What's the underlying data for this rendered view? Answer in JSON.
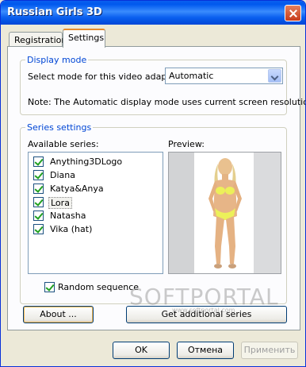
{
  "window": {
    "title": "Russian Girls 3D"
  },
  "tabs": [
    {
      "label": "Registration"
    },
    {
      "label": "Settings"
    }
  ],
  "display_mode": {
    "group_title": "Display mode",
    "select_label": "Select mode for this video adapter :",
    "select_value": "Automatic",
    "note": "Note: The Automatic display mode uses current screen resolution."
  },
  "series_settings": {
    "group_title": "Series settings",
    "available_label": "Available series:",
    "preview_label": "Preview:",
    "items": [
      {
        "label": "Anything3DLogo",
        "checked": true
      },
      {
        "label": "Diana",
        "checked": true
      },
      {
        "label": "Katya&Anya",
        "checked": true
      },
      {
        "label": "Lora",
        "checked": true,
        "selected": true
      },
      {
        "label": "Natasha",
        "checked": true
      },
      {
        "label": "Vika (hat)",
        "checked": true
      }
    ],
    "random_label": "Random sequence",
    "random_checked": true
  },
  "buttons": {
    "about": "About ...",
    "get_additional": "Get additional series",
    "ok": "OK",
    "cancel": "Отмена",
    "apply": "Применить"
  },
  "watermark": {
    "text": "SOFTPORTAL",
    "sub": "www.softportal.com"
  },
  "colors": {
    "titlebar": "#0a5fef",
    "accent": "#0046d5",
    "face": "#ece9d8"
  }
}
